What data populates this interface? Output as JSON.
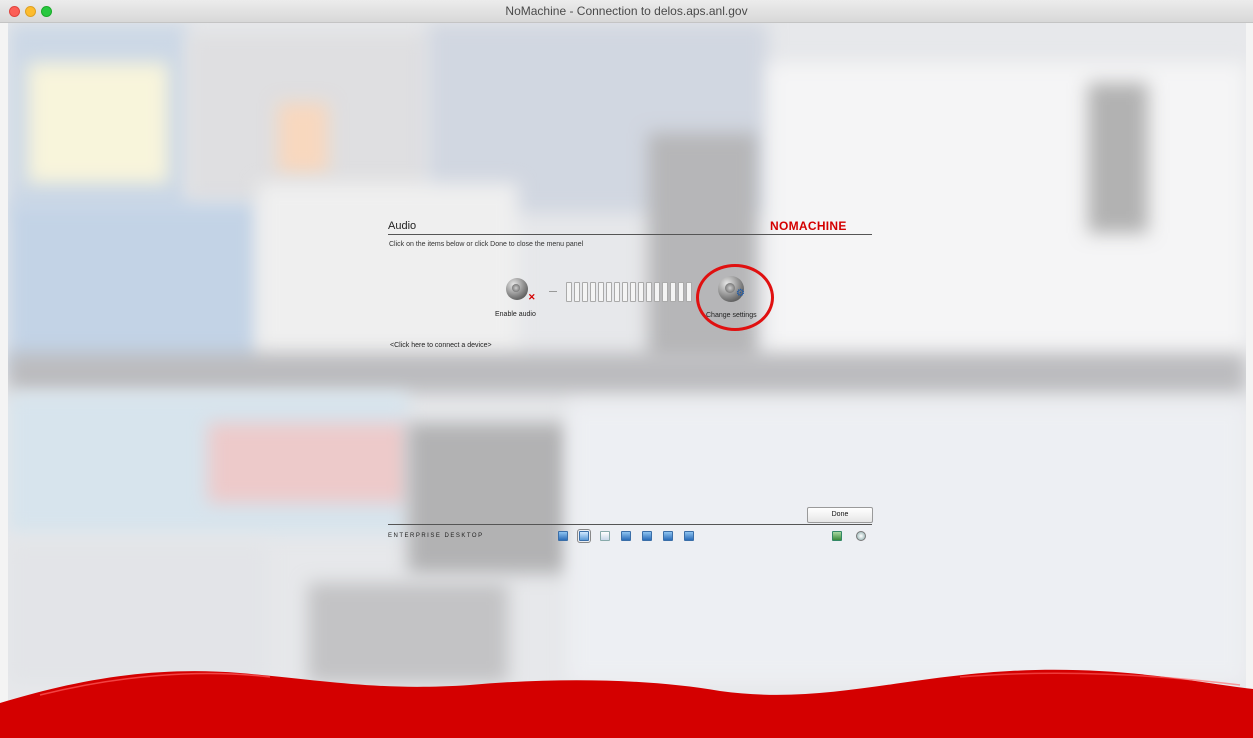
{
  "window": {
    "title": "NoMachine - Connection to delos.aps.anl.gov"
  },
  "panel": {
    "title": "Audio",
    "logo_text": "NOMACHINE",
    "instructions": "Click on the items below or click Done to close the menu panel",
    "connect_device": "<Click here to connect a device>",
    "done": "Done"
  },
  "audio": {
    "enable_label": "Enable audio",
    "settings_label": "Change settings"
  },
  "toolbar": {
    "brand": "ENTERPRISE DESKTOP",
    "icons": [
      "display-icon",
      "fit-icon",
      "menu-icon",
      "audio-icon",
      "devices-icon",
      "screen-icon",
      "settings-icon"
    ],
    "right_icons": [
      "monitor-icon",
      "help-icon"
    ]
  },
  "colors": {
    "brand_red": "#d40000",
    "highlight_ring": "#e01010"
  }
}
